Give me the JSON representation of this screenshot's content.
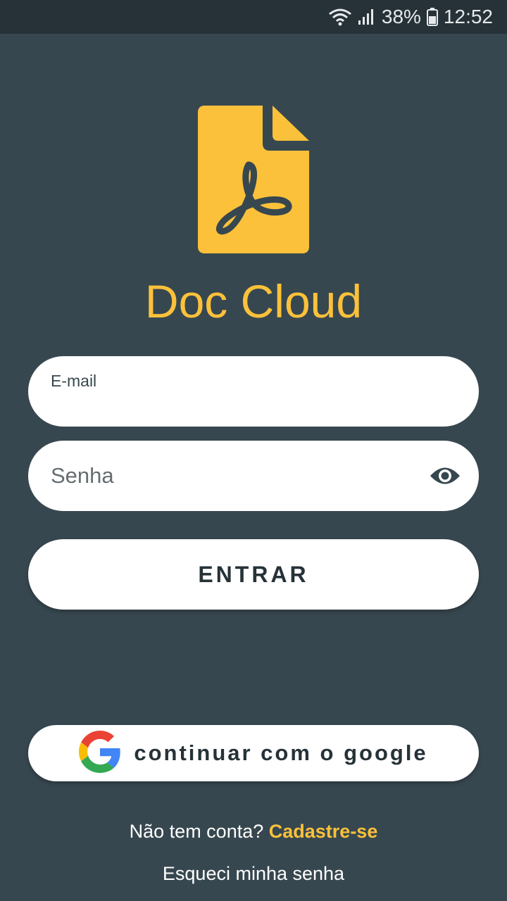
{
  "status_bar": {
    "battery": "38%",
    "time": "12:52",
    "icons": [
      "wifi-icon",
      "signal-icon",
      "battery-icon"
    ]
  },
  "app": {
    "title": "Doc Cloud",
    "logo_icon": "pdf-document-icon"
  },
  "login_form": {
    "email_label": "E-mail",
    "email_value": "",
    "password_placeholder": "Senha",
    "password_value": "",
    "password_toggle_icon": "eye-icon",
    "submit_label": "ENTRAR"
  },
  "google": {
    "label": "continuar com o google",
    "icon": "google-logo-icon"
  },
  "footer": {
    "no_account_text": "Não tem conta?",
    "signup_label": "Cadastre-se",
    "forgot_label": "Esqueci minha senha"
  },
  "colors": {
    "background": "#37474f",
    "status_bar": "#263238",
    "accent": "#fbc13a",
    "button_bg": "#ffffff",
    "button_text": "#263238"
  }
}
